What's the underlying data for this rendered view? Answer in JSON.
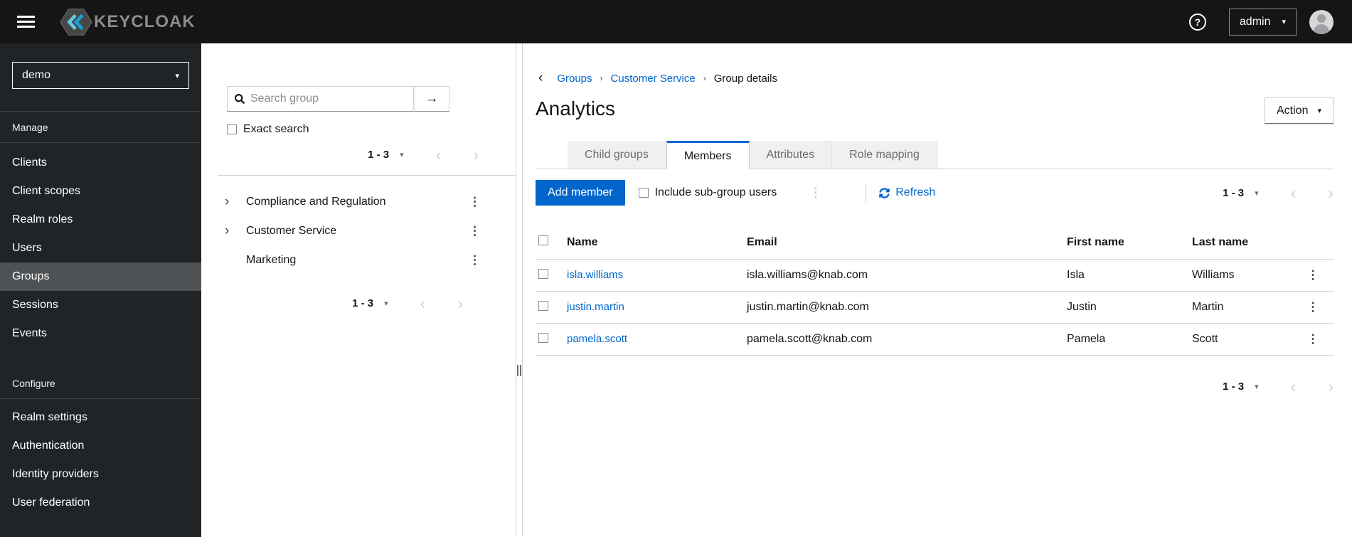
{
  "glyphs": {
    "caret_down": "▾",
    "chevron_right": "›",
    "chevron_left": "‹",
    "kebab": "⋮",
    "arrow_right": "→",
    "question": "?"
  },
  "colors": {
    "primary": "#0066cc",
    "link": "#0066cc",
    "masthead_bg": "#151515",
    "sidebar_bg": "#212427",
    "sidebar_active_bg": "#4f5255",
    "tab_inactive_bg": "#f0f0f0",
    "border": "#d2d2d2"
  },
  "masthead": {
    "brand": "KEYCLOAK",
    "user": "admin"
  },
  "sidebar": {
    "realm": "demo",
    "sections": [
      {
        "label": "Manage",
        "items": [
          {
            "label": "Clients"
          },
          {
            "label": "Client scopes"
          },
          {
            "label": "Realm roles"
          },
          {
            "label": "Users"
          },
          {
            "label": "Groups",
            "active": true
          },
          {
            "label": "Sessions"
          },
          {
            "label": "Events"
          }
        ]
      },
      {
        "label": "Configure",
        "items": [
          {
            "label": "Realm settings"
          },
          {
            "label": "Authentication"
          },
          {
            "label": "Identity providers"
          },
          {
            "label": "User federation"
          }
        ]
      }
    ]
  },
  "group_panel": {
    "search_placeholder": "Search group",
    "exact_search_label": "Exact search",
    "pagination_top": {
      "range": "1 - 3"
    },
    "pagination_bottom": {
      "range": "1 - 3"
    },
    "tree": [
      {
        "label": "Compliance and Regulation",
        "expandable": true
      },
      {
        "label": "Customer Service",
        "expandable": true
      },
      {
        "label": "Marketing",
        "expandable": false
      }
    ]
  },
  "main": {
    "breadcrumb": {
      "items": [
        {
          "label": "Groups",
          "link": true
        },
        {
          "label": "Customer Service",
          "link": true
        },
        {
          "label": "Group details",
          "link": false
        }
      ]
    },
    "title": "Analytics",
    "action_label": "Action",
    "tabs": [
      {
        "label": "Child groups"
      },
      {
        "label": "Members",
        "active": true
      },
      {
        "label": "Attributes"
      },
      {
        "label": "Role mapping"
      }
    ],
    "toolbar": {
      "add_member_label": "Add member",
      "include_subgroup_label": "Include sub-group users",
      "refresh_label": "Refresh",
      "pagination": {
        "range": "1 - 3"
      }
    },
    "table": {
      "columns": [
        "Name",
        "Email",
        "First name",
        "Last name"
      ],
      "rows": [
        {
          "name": "isla.williams",
          "email": "isla.williams@knab.com",
          "first": "Isla",
          "last": "Williams"
        },
        {
          "name": "justin.martin",
          "email": "justin.martin@knab.com",
          "first": "Justin",
          "last": "Martin"
        },
        {
          "name": "pamela.scott",
          "email": "pamela.scott@knab.com",
          "first": "Pamela",
          "last": "Scott"
        }
      ]
    },
    "pagination_bottom": {
      "range": "1 - 3"
    }
  }
}
